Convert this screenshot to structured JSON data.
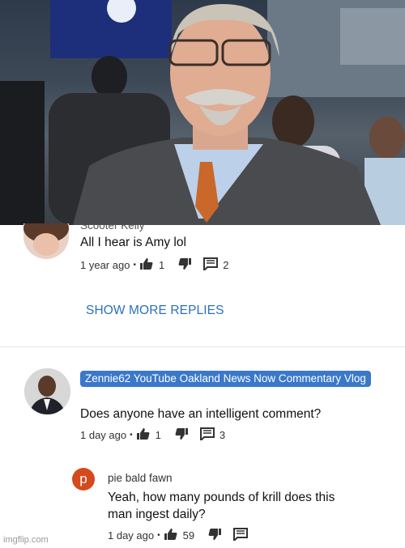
{
  "photo": {
    "alt": "man with mustache and glasses in suit"
  },
  "reply1": {
    "author": "Scooter Kelly",
    "text": "All I hear is Amy lol",
    "time": "1 year ago",
    "likes": "1",
    "replies": "2"
  },
  "show_more": "SHOW MORE REPLIES",
  "comment": {
    "author": "Zennie62 YouTube Oakland News Now Commentary Vlog",
    "text": "Does anyone have an intelligent comment?",
    "time": "1 day ago",
    "likes": "1",
    "replies": "3"
  },
  "reply2": {
    "avatar_letter": "p",
    "author": "pie bald fawn",
    "text_line1": "Yeah, how many pounds of krill does this",
    "text_line2": "man ingest daily?",
    "time": "1 day ago",
    "likes": "59"
  },
  "separator": "•",
  "watermark": "imgflip.com",
  "colors": {
    "link_blue": "#2a6fc4",
    "badge_blue": "#3a78c9",
    "avatar_red": "#d44a1d"
  }
}
